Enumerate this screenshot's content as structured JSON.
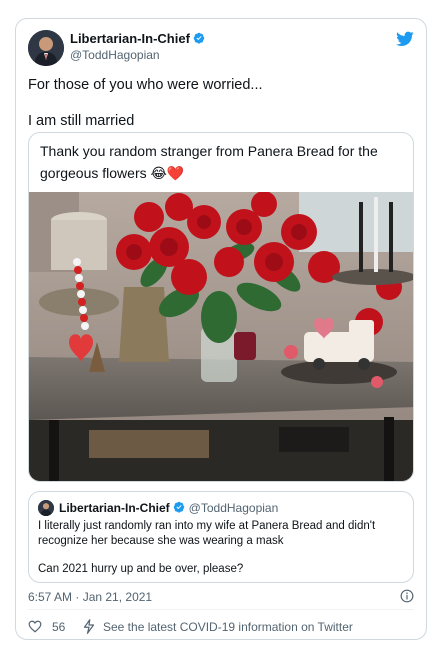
{
  "author": {
    "name": "Libertarian-In-Chief",
    "handle": "@ToddHagopian"
  },
  "tweet": {
    "line1": "For those of you who were worried...",
    "line2": "I am still married"
  },
  "embedded": {
    "text": "Thank you random stranger from Panera Bread for the gorgeous flowers 😂❤️"
  },
  "quoted": {
    "name": "Libertarian-In-Chief",
    "handle": "@ToddHagopian",
    "text1": "I literally just randomly ran into my wife at Panera Bread and didn't recognize her because she was wearing a mask",
    "text2": "Can 2021 hurry up and be over, please?"
  },
  "footer": {
    "timestamp": "6:57 AM · Jan 21, 2021",
    "likes": "56",
    "covid_link": "See the latest COVID-19 information on Twitter"
  },
  "colors": {
    "twitter_blue": "#1d9bf0",
    "secondary_text": "#536471",
    "border": "#cfd9de"
  },
  "icons": [
    "verified-icon",
    "twitter-bird-icon",
    "info-icon",
    "heart-icon",
    "lightning-icon"
  ]
}
